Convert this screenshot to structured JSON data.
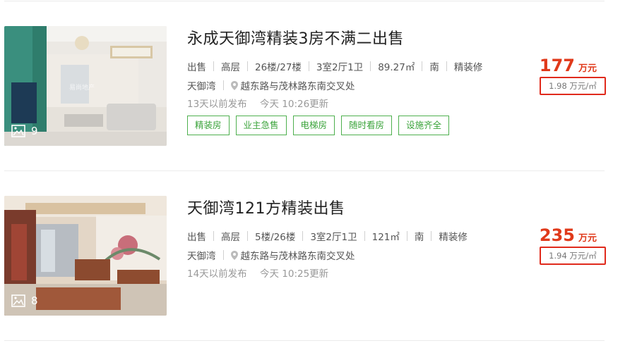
{
  "listings": [
    {
      "title": "永成天御湾精装3房不满二出售",
      "attributes": [
        "出售",
        "高层",
        "26楼/27楼",
        "3室2厅1卫",
        "89.27㎡",
        "南",
        "精装修"
      ],
      "community": "天御湾",
      "address": "越东路与茂林路东南交叉处",
      "published": "13天以前发布",
      "updated": "今天 10:26更新",
      "tags": [
        "精装房",
        "业主急售",
        "电梯房",
        "随时看房",
        "设施齐全"
      ],
      "image_count": "9",
      "price": "177",
      "price_unit": "万元",
      "unit_price": "1.98 万元/㎡",
      "watermark": "易尚地产"
    },
    {
      "title": "天御湾121方精装出售",
      "attributes": [
        "出售",
        "高层",
        "5楼/26楼",
        "3室2厅1卫",
        "121㎡",
        "南",
        "精装修"
      ],
      "community": "天御湾",
      "address": "越东路与茂林路东南交叉处",
      "published": "14天以前发布",
      "updated": "今天 10:25更新",
      "tags": [],
      "image_count": "8",
      "price": "235",
      "price_unit": "万元",
      "unit_price": "1.94 万元/㎡"
    }
  ],
  "icons": {
    "image": "picture-icon",
    "location": "map-pin-icon"
  },
  "colors": {
    "price": "#e0391a",
    "tag_border": "#4eb04e",
    "highlight_box": "#e02a1c"
  }
}
